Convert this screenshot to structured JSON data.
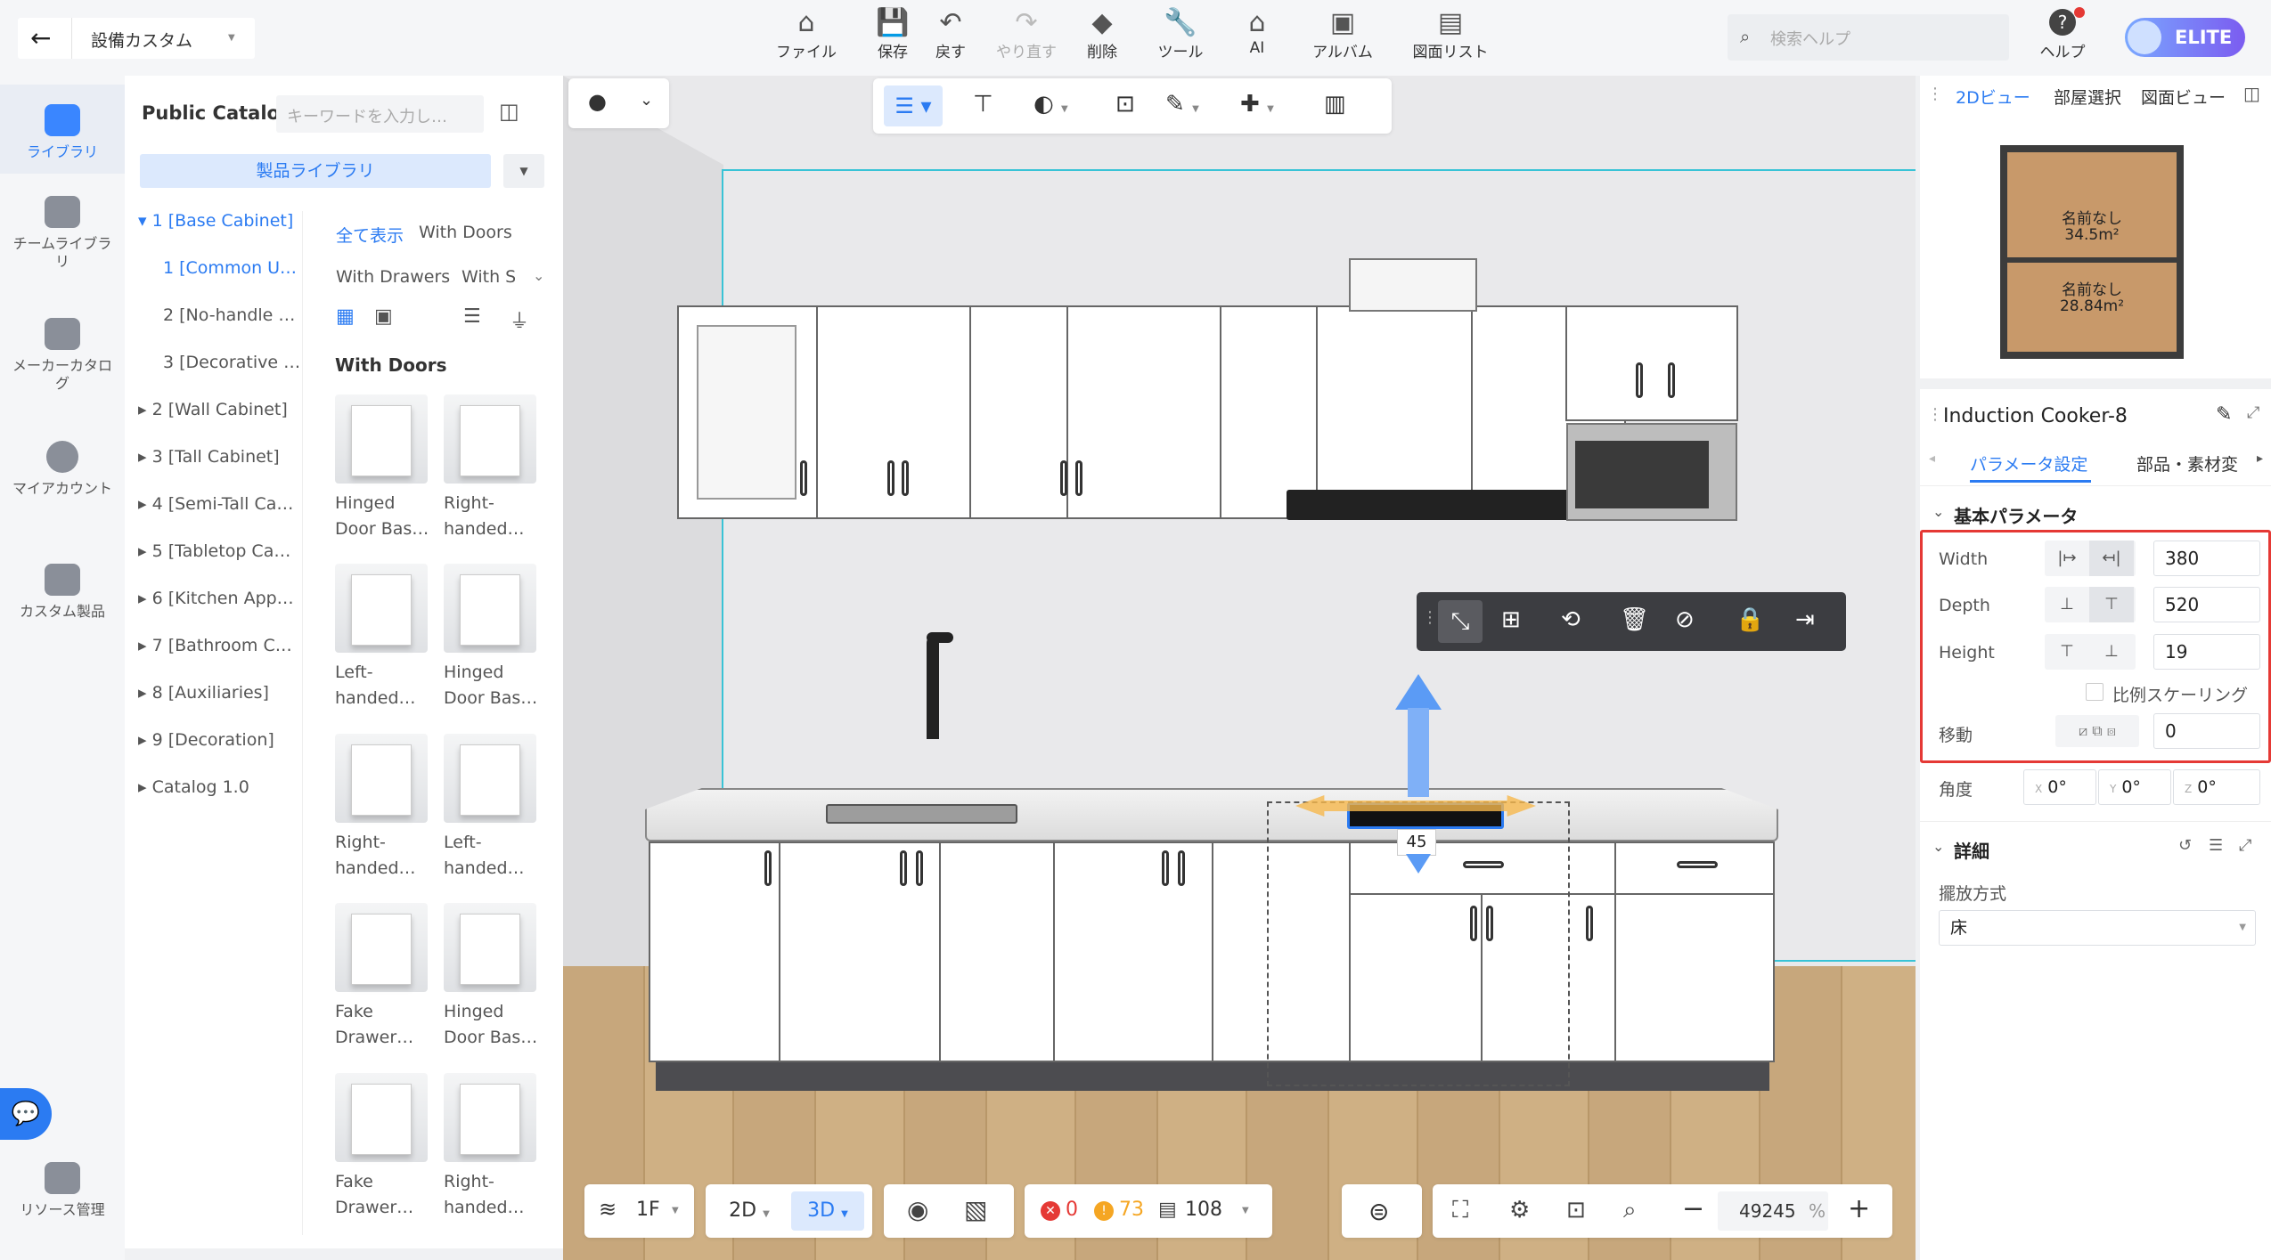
{
  "topbar": {
    "project_name": "設備カスタム",
    "tools": [
      {
        "label": "ファイル",
        "icon": "file-icon"
      },
      {
        "label": "保存",
        "icon": "save-icon"
      },
      {
        "label": "戻す",
        "icon": "undo-icon"
      },
      {
        "label": "やり直す",
        "icon": "redo-icon"
      },
      {
        "label": "削除",
        "icon": "eraser-icon"
      },
      {
        "label": "ツール",
        "icon": "wrench-icon"
      },
      {
        "label": "AI",
        "icon": "ai-house-icon"
      },
      {
        "label": "アルバム",
        "icon": "album-icon"
      },
      {
        "label": "図面リスト",
        "icon": "drawing-list-icon"
      }
    ],
    "search_placeholder": "検索ヘルプ",
    "help_label": "ヘルプ",
    "badge": "ELITE"
  },
  "rail": [
    {
      "label": "ライブラリ",
      "selected": true
    },
    {
      "label": "チームライブラリ"
    },
    {
      "label": "メーカーカタログ"
    },
    {
      "label": "マイアカウント"
    },
    {
      "label": "カスタム製品"
    },
    {
      "label": "リソース管理"
    }
  ],
  "catalog": {
    "title": "Public Catalog",
    "search_placeholder": "キーワードを入力し…",
    "library_button": "製品ライブラリ",
    "tree": [
      "1 [Base Cabinet]",
      "1 [Common U…",
      "2 [No-handle …",
      "3 [Decorative …",
      "2 [Wall Cabinet]",
      "3 [Tall Cabinet]",
      "4 [Semi-Tall Ca…",
      "5 [Tabletop Ca…",
      "6 [Kitchen App…",
      "7 [Bathroom C…",
      "8 [Auxiliaries]",
      "9 [Decoration]",
      "Catalog 1.0"
    ],
    "filters": [
      "全て表示",
      "With Doors",
      "With Drawers",
      "With Si"
    ],
    "section_title": "With Doors",
    "products": [
      [
        "Hinged",
        "Door Bas…"
      ],
      [
        "Right-",
        "handed…"
      ],
      [
        "Left-",
        "handed…"
      ],
      [
        "Hinged",
        "Door Bas…"
      ],
      [
        "Right-",
        "handed…"
      ],
      [
        "Left-",
        "handed…"
      ],
      [
        "Fake",
        "Drawer…"
      ],
      [
        "Hinged",
        "Door Bas…"
      ],
      [
        "Fake",
        "Drawer…"
      ],
      [
        "Right-",
        "handed…"
      ]
    ]
  },
  "viewport": {
    "dimension_label": "45",
    "bottom": {
      "floor": "1F",
      "view2d": "2D",
      "view3d": "3D",
      "errors": "0",
      "warnings": "73",
      "items": "108",
      "zoom": "49245",
      "zoom_unit": "%"
    }
  },
  "right": {
    "tabs": [
      "2Dビュー",
      "部屋選択",
      "図面ビュー"
    ],
    "rooms": [
      {
        "name": "名前なし",
        "area": "34.5m²"
      },
      {
        "name": "名前なし",
        "area": "28.84m²"
      }
    ],
    "object_title": "Induction Cooker-8",
    "prop_tabs": [
      "パラメータ設定",
      "部品・素材変"
    ],
    "basic_title": "基本パラメータ",
    "width_label": "Width",
    "width": "380",
    "depth_label": "Depth",
    "depth": "520",
    "height_label": "Height",
    "height": "19",
    "scale_label": "比例スケーリング",
    "move_label": "移動",
    "move": "0",
    "angle_label": "角度",
    "angle_x": "0°",
    "angle_y": "0°",
    "angle_z": "0°",
    "axis_x": "X",
    "axis_y": "Y",
    "axis_z": "Z",
    "detail_title": "詳細",
    "placement_label": "擺放方式",
    "placement_value": "床"
  },
  "colors": {
    "accent": "#2b7bf2",
    "highlight": "#e53935",
    "elite": "#6c5ce7"
  }
}
